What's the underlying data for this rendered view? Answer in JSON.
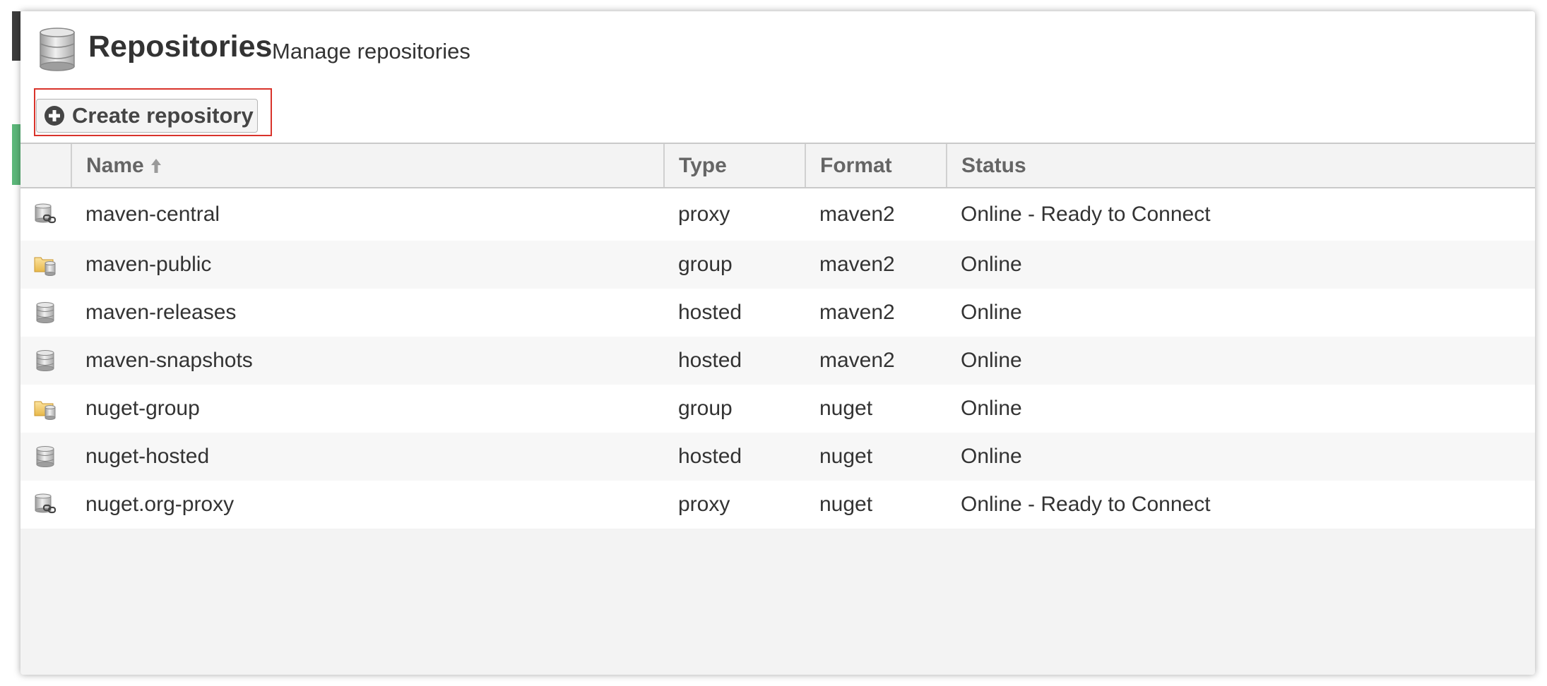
{
  "header": {
    "title": "Repositories",
    "subtitle": "Manage repositories",
    "title_icon": "database-icon"
  },
  "toolbar": {
    "create_label": "Create repository",
    "create_icon": "plus-circle-icon"
  },
  "table": {
    "columns": {
      "name": "Name",
      "type": "Type",
      "format": "Format",
      "status": "Status"
    },
    "sort": {
      "column": "name",
      "direction": "ascending",
      "icon": "arrow-up-icon"
    },
    "rows": [
      {
        "icon": "proxy-repository-icon",
        "name": "maven-central",
        "type": "proxy",
        "format": "maven2",
        "status": "Online - Ready to Connect"
      },
      {
        "icon": "group-repository-icon",
        "name": "maven-public",
        "type": "group",
        "format": "maven2",
        "status": "Online"
      },
      {
        "icon": "hosted-repository-icon",
        "name": "maven-releases",
        "type": "hosted",
        "format": "maven2",
        "status": "Online"
      },
      {
        "icon": "hosted-repository-icon",
        "name": "maven-snapshots",
        "type": "hosted",
        "format": "maven2",
        "status": "Online"
      },
      {
        "icon": "group-repository-icon",
        "name": "nuget-group",
        "type": "group",
        "format": "nuget",
        "status": "Online"
      },
      {
        "icon": "hosted-repository-icon",
        "name": "nuget-hosted",
        "type": "hosted",
        "format": "nuget",
        "status": "Online"
      },
      {
        "icon": "proxy-repository-icon",
        "name": "nuget.org-proxy",
        "type": "proxy",
        "format": "nuget",
        "status": "Online - Ready to Connect"
      }
    ]
  },
  "colors": {
    "highlight_border": "#d9332b",
    "sidebar_accent": "#5cb87a",
    "header_text": "#656565",
    "body_text": "#333333"
  }
}
